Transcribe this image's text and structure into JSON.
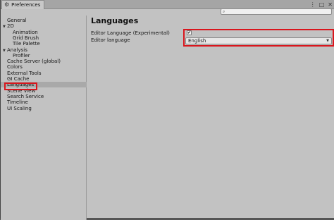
{
  "window": {
    "tab_title": "Preferences",
    "tab_icon": "gear-icon",
    "controls": [
      "kebab-menu-icon",
      "maximize-icon",
      "close-icon"
    ]
  },
  "search": {
    "placeholder": ""
  },
  "sidebar": {
    "items": [
      {
        "label": "General",
        "indent": 0,
        "arrow": ""
      },
      {
        "label": "2D",
        "indent": 0,
        "arrow": "▼"
      },
      {
        "label": "Animation",
        "indent": 1,
        "arrow": ""
      },
      {
        "label": "Grid Brush",
        "indent": 1,
        "arrow": ""
      },
      {
        "label": "Tile Palette",
        "indent": 1,
        "arrow": ""
      },
      {
        "label": "Analysis",
        "indent": 0,
        "arrow": "▼"
      },
      {
        "label": "Profiler",
        "indent": 1,
        "arrow": ""
      },
      {
        "label": "Cache Server (global)",
        "indent": 0,
        "arrow": ""
      },
      {
        "label": "Colors",
        "indent": 0,
        "arrow": ""
      },
      {
        "label": "External Tools",
        "indent": 0,
        "arrow": ""
      },
      {
        "label": "GI Cache",
        "indent": 0,
        "arrow": ""
      },
      {
        "label": "Languages",
        "indent": 0,
        "arrow": "",
        "selected": true
      },
      {
        "label": "Scene View",
        "indent": 0,
        "arrow": ""
      },
      {
        "label": "Search Service",
        "indent": 0,
        "arrow": ""
      },
      {
        "label": "Timeline",
        "indent": 0,
        "arrow": ""
      },
      {
        "label": "UI Scaling",
        "indent": 0,
        "arrow": ""
      }
    ]
  },
  "main": {
    "title": "Languages",
    "editor_language_experimental": {
      "label": "Editor Language (Experimental)",
      "checked": true,
      "check_mark": "✔"
    },
    "editor_language": {
      "label": "Editor language",
      "value": "English",
      "arrow": "▼"
    }
  },
  "colors": {
    "highlight": "#d9161d",
    "background": "#c2c2c2",
    "selected_row": "#a9a9a9"
  }
}
